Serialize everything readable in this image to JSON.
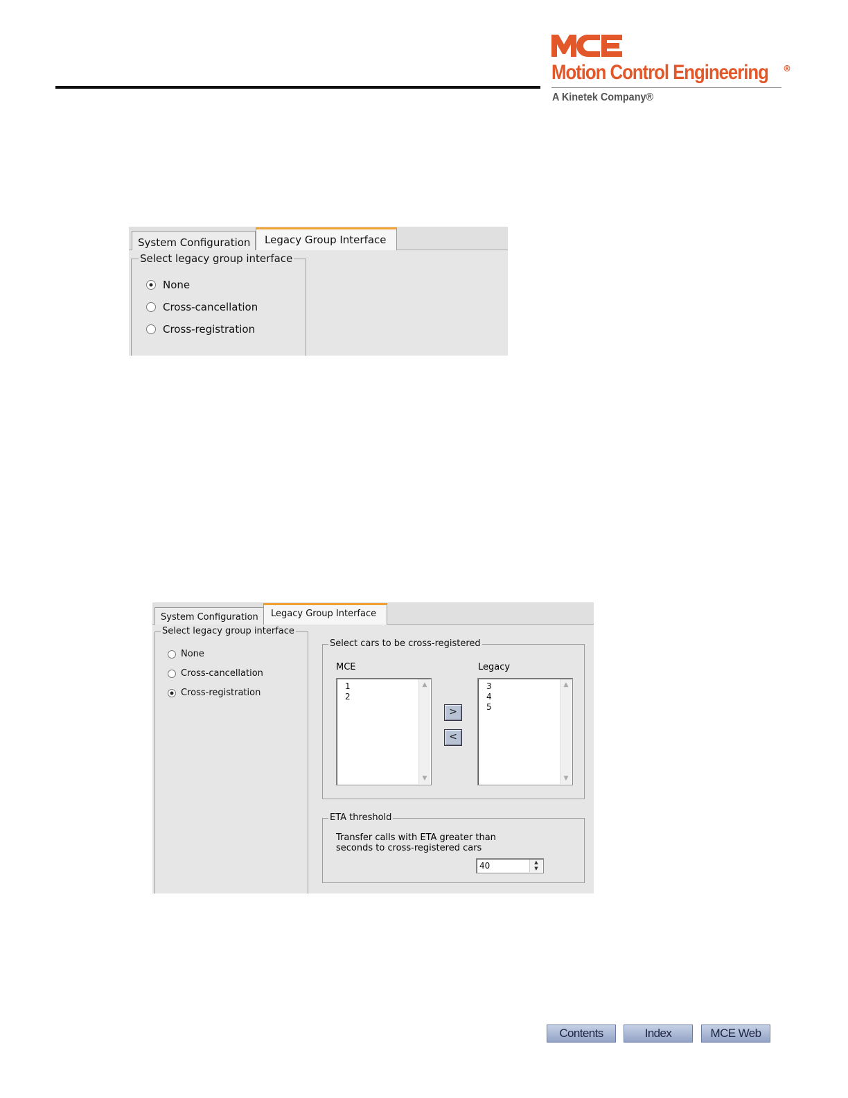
{
  "logo": {
    "mark": "MCE",
    "name": "Motion Control Engineering",
    "registered": "®",
    "subtitle": "A Kinetek Company®",
    "brand_color": "#e2582a"
  },
  "dialog1": {
    "tabs": [
      {
        "label": "System Configuration",
        "active": false
      },
      {
        "label": "Legacy Group Interface",
        "active": true
      }
    ],
    "group_title": "Select legacy group interface",
    "options": [
      {
        "label": "None",
        "checked": true
      },
      {
        "label": "Cross-cancellation",
        "checked": false
      },
      {
        "label": "Cross-registration",
        "checked": false
      }
    ]
  },
  "dialog2": {
    "tabs": [
      {
        "label": "System Configuration",
        "active": false
      },
      {
        "label": "Legacy Group Interface",
        "active": true
      }
    ],
    "group_title": "Select legacy group interface",
    "options": [
      {
        "label": "None",
        "checked": false
      },
      {
        "label": "Cross-cancellation",
        "checked": false
      },
      {
        "label": "Cross-registration",
        "checked": true
      }
    ],
    "cars_group_title": "Select cars to be cross-registered",
    "mce_label": "MCE",
    "mce_cars": [
      "1",
      "2"
    ],
    "legacy_label": "Legacy",
    "legacy_cars": [
      "3",
      "4",
      "5"
    ],
    "move_right": ">",
    "move_left": "<",
    "eta_group_title": "ETA threshold",
    "eta_line1": "Transfer calls with ETA greater than",
    "eta_line2": "seconds to cross-registered cars",
    "eta_value": "40"
  },
  "footer": {
    "contents": "Contents",
    "index": "Index",
    "web": "MCE Web"
  }
}
